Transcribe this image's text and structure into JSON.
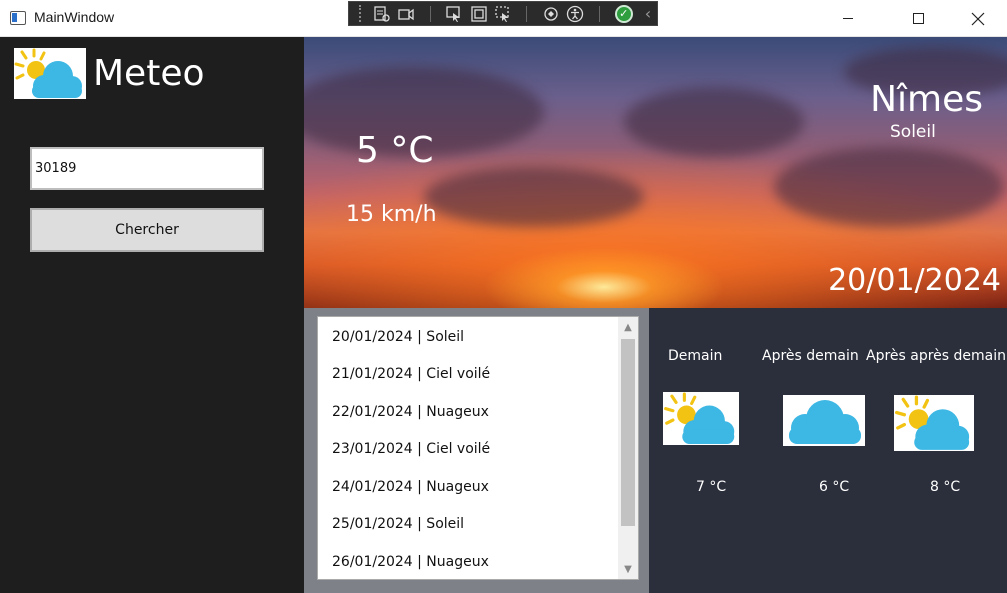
{
  "window": {
    "title": "MainWindow",
    "controls": [
      "minimize-icon",
      "maximize-icon",
      "close-icon"
    ]
  },
  "dev_toolbar": {
    "icons": [
      "live-visual-tree-icon",
      "video-icon",
      "select-element-icon",
      "display-layout-adorners-icon",
      "track-focus-icon",
      "hot-reload-icon",
      "accessibility-icon",
      "check-icon",
      "collapse-icon"
    ]
  },
  "sidebar": {
    "app_name": "Meteo",
    "zip_value": "30189",
    "search_label": "Chercher"
  },
  "current": {
    "temperature": "5 °C",
    "wind": "15 km/h",
    "city": "Nîmes",
    "condition": "Soleil",
    "date": "20/01/2024"
  },
  "forecast_list": [
    "20/01/2024 | Soleil",
    "21/01/2024 | Ciel voilé",
    "22/01/2024 | Nuageux",
    "23/01/2024 | Ciel voilé",
    "24/01/2024 | Nuageux",
    "25/01/2024 | Soleil",
    "26/01/2024 | Nuageux"
  ],
  "next_days": [
    {
      "label": "Demain",
      "temp": "7 °C",
      "icon": "sun-cloud-icon"
    },
    {
      "label": "Après demain",
      "temp": "6 °C",
      "icon": "cloud-icon"
    },
    {
      "label": "Après après demain",
      "temp": "8 °C",
      "icon": "sun-cloud-icon"
    }
  ],
  "colors": {
    "cloud": "#3db7e4",
    "sun": "#f2c312",
    "sidebar_bg": "#1f1e1f",
    "days_bg": "#2b2e3b"
  }
}
